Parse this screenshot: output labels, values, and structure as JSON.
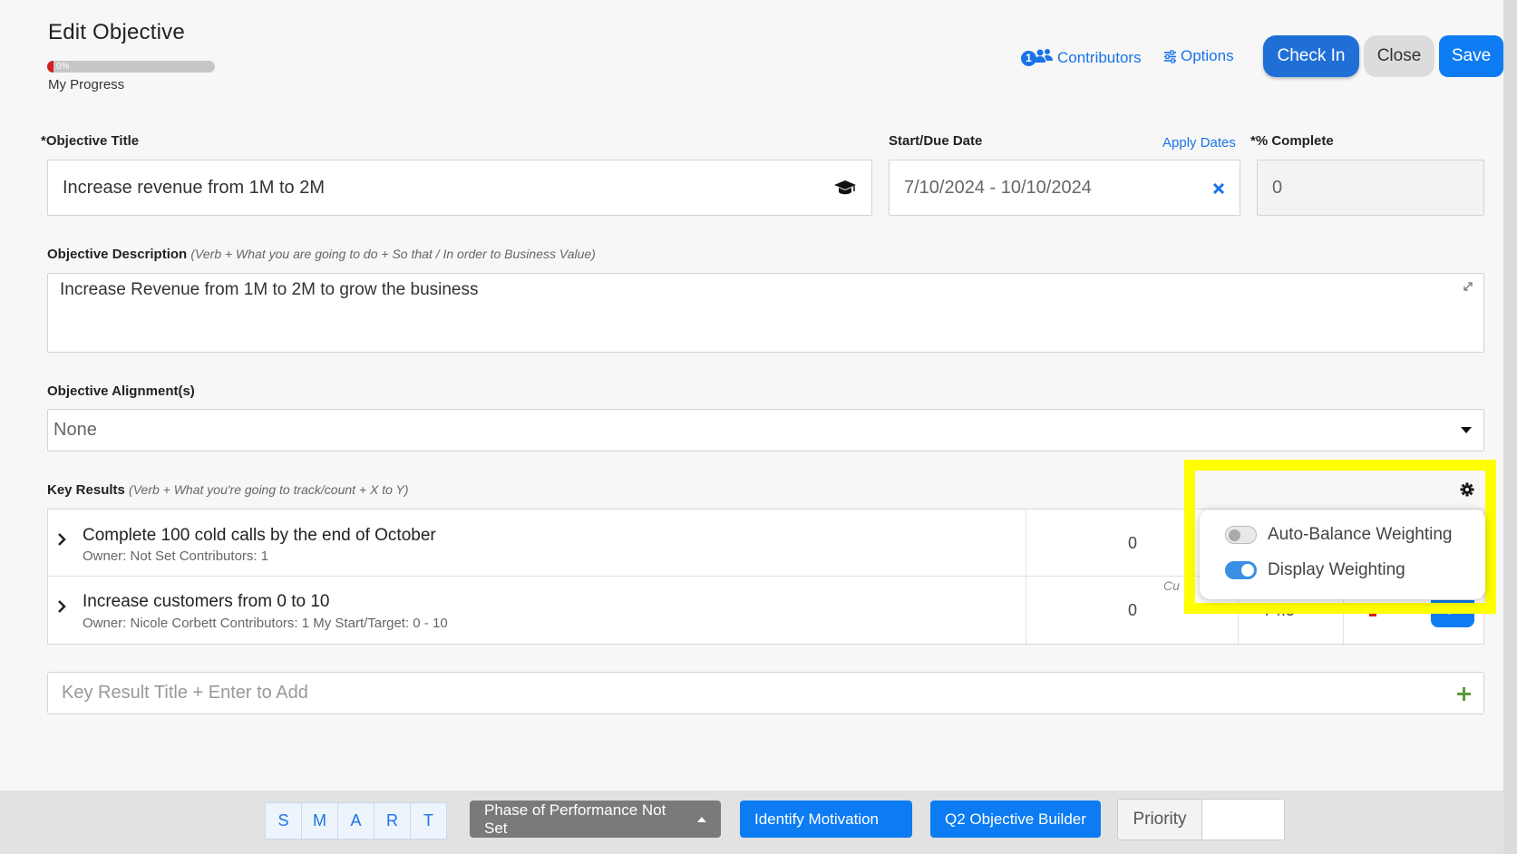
{
  "header": {
    "title": "Edit Objective",
    "progress_text": "0%",
    "progress_value": 0,
    "progress_label": "My Progress",
    "contributors_count": "1",
    "contributors_label": "Contributors",
    "options_label": "Options",
    "check_in_label": "Check In",
    "close_label": "Close",
    "save_label": "Save"
  },
  "form": {
    "title_label": "*Objective Title",
    "title_value": "Increase revenue from 1M to 2M",
    "date_label": "Start/Due Date",
    "apply_dates_label": "Apply Dates",
    "date_value": "7/10/2024 - 10/10/2024",
    "complete_label": "*% Complete",
    "complete_value": "0",
    "description_label": "Objective Description",
    "description_hint": "(Verb + What you are going to do + So that / In order to Business Value)",
    "description_value": "Increase Revenue from 1M to 2M to grow the business",
    "alignment_label": "Objective Alignment(s)",
    "alignment_value": "None"
  },
  "key_results": {
    "label": "Key Results",
    "hint": "(Verb + What you're going to track/count + X to Y)",
    "rows": [
      {
        "title": "Complete 100 cold calls by the end of October",
        "meta": "Owner: Not Set    Contributors: 1",
        "value": "0"
      },
      {
        "title": "Increase customers from 0 to 10",
        "meta": "Owner: Nicole Corbett    Contributors: 1    My Start/Target: 0 - 10",
        "value": "0",
        "partial_label": "Cu",
        "partial_value": "74.5"
      }
    ],
    "add_placeholder": "Key Result Title + Enter to Add"
  },
  "weighting_menu": {
    "auto_balance_label": "Auto-Balance Weighting",
    "auto_balance_on": false,
    "display_label": "Display Weighting",
    "display_on": true
  },
  "footer": {
    "smart": [
      "S",
      "M",
      "A",
      "R",
      "T"
    ],
    "phase_label": "Phase of Performance Not Set",
    "motivation_label": "Identify Motivation",
    "builder_label": "Q2 Objective Builder",
    "priority_label": "Priority"
  },
  "colors": {
    "accent": "#1a73e8",
    "primary_button": "#0d7cf2",
    "progress_fill": "#d42020",
    "highlight": "#ffff00"
  }
}
